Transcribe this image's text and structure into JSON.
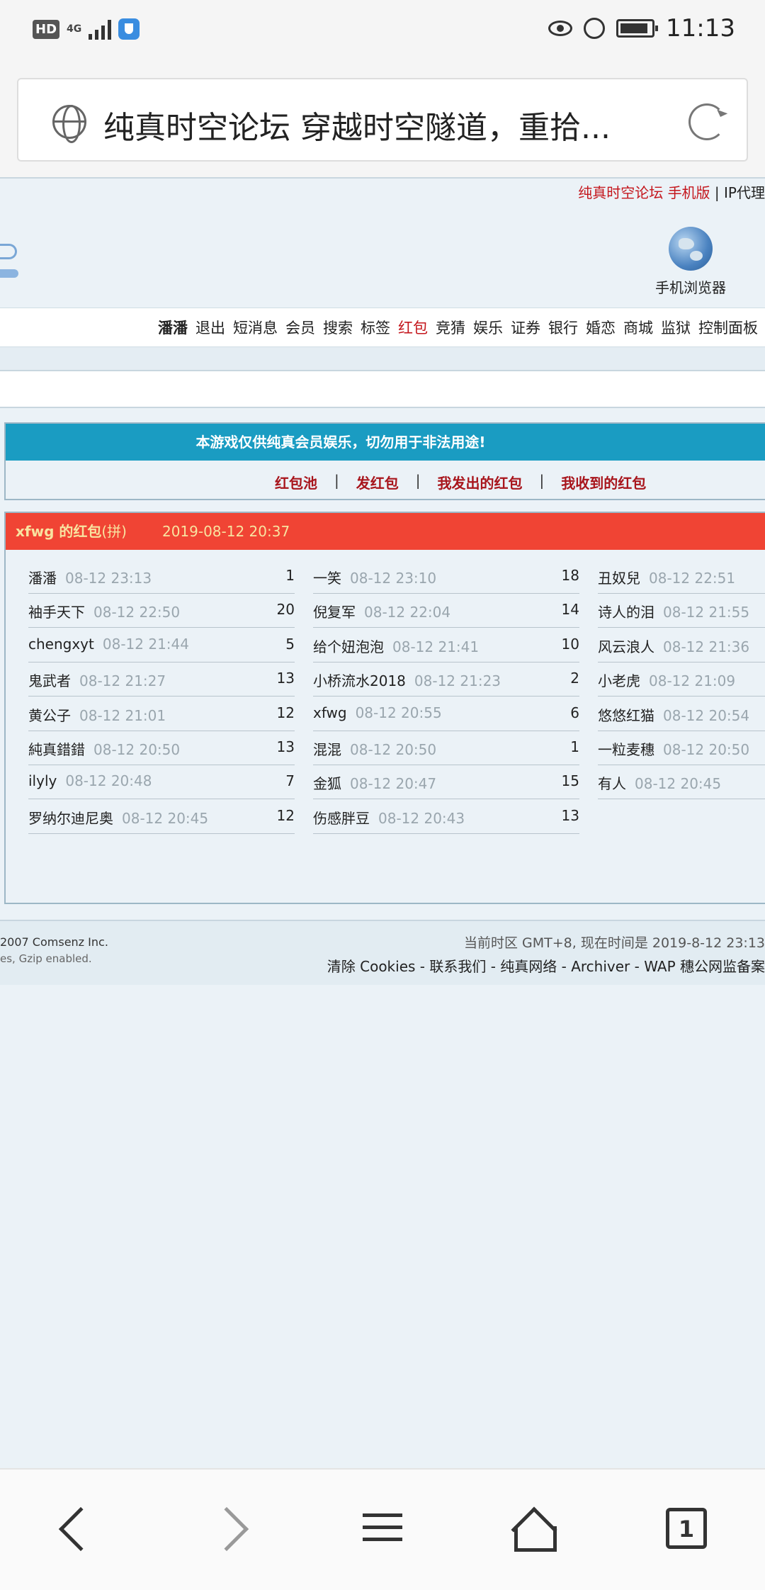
{
  "status_bar": {
    "hd": "HD",
    "network": "4G",
    "time": "11:13"
  },
  "address_bar": {
    "title": "纯真时空论坛 穿越时空隧道，重拾..."
  },
  "top_links": {
    "forum": "纯真时空论坛",
    "mobile": "手机版",
    "separator": "|",
    "ip": "IP代理"
  },
  "mobile_browser": {
    "label": "手机浏览器"
  },
  "nav": {
    "user": "潘潘",
    "items": [
      "退出",
      "短消息",
      "会员",
      "搜索",
      "标签",
      "红包",
      "竞猜",
      "娱乐",
      "证券",
      "银行",
      "婚恋",
      "商城",
      "监狱",
      "控制面板"
    ],
    "active": "红包"
  },
  "notice": {
    "text": "本游戏仅供纯真会员娱乐，切勿用于非法用途!",
    "links": [
      "红包池",
      "发红包",
      "我发出的红包",
      "我收到的红包"
    ],
    "separator": "|"
  },
  "redpacket": {
    "owner": "xfwg 的红包",
    "type": "(拼)",
    "date": "2019-08-12 20:37",
    "entries": [
      {
        "name": "潘潘",
        "time": "08-12 23:13",
        "count": "1"
      },
      {
        "name": "一笑",
        "time": "08-12 23:10",
        "count": "18"
      },
      {
        "name": "丑奴兒",
        "time": "08-12 22:51",
        "count": ""
      },
      {
        "name": "袖手天下",
        "time": "08-12 22:50",
        "count": "20"
      },
      {
        "name": "倪复军",
        "time": "08-12 22:04",
        "count": "14"
      },
      {
        "name": "诗人的泪",
        "time": "08-12 21:55",
        "count": ""
      },
      {
        "name": "chengxyt",
        "time": "08-12 21:44",
        "count": "5"
      },
      {
        "name": "给个妞泡泡",
        "time": "08-12 21:41",
        "count": "10"
      },
      {
        "name": "风云浪人",
        "time": "08-12 21:36",
        "count": ""
      },
      {
        "name": "鬼武者",
        "time": "08-12 21:27",
        "count": "13"
      },
      {
        "name": "小桥流水2018",
        "time": "08-12 21:23",
        "count": "2"
      },
      {
        "name": "小老虎",
        "time": "08-12 21:09",
        "count": ""
      },
      {
        "name": "黄公子",
        "time": "08-12 21:01",
        "count": "12"
      },
      {
        "name": "xfwg",
        "time": "08-12 20:55",
        "count": "6"
      },
      {
        "name": "悠悠红猫",
        "time": "08-12 20:54",
        "count": ""
      },
      {
        "name": "純真錯錯",
        "time": "08-12 20:50",
        "count": "13"
      },
      {
        "name": "混混",
        "time": "08-12 20:50",
        "count": "1"
      },
      {
        "name": "一粒麦穗",
        "time": "08-12 20:50",
        "count": ""
      },
      {
        "name": "ilyly",
        "time": "08-12 20:48",
        "count": "7"
      },
      {
        "name": "金狐",
        "time": "08-12 20:47",
        "count": "15"
      },
      {
        "name": "有人",
        "time": "08-12 20:45",
        "count": ""
      },
      {
        "name": "罗纳尔迪尼奥",
        "time": "08-12 20:45",
        "count": "12"
      },
      {
        "name": "伤感胖豆",
        "time": "08-12 20:43",
        "count": "13"
      }
    ]
  },
  "footer": {
    "copyright": "2007 Comsenz Inc.",
    "gzip": "es, Gzip enabled.",
    "timezone": "当前时区 GMT+8, 现在时间是 2019-8-12 23:13",
    "links": "清除 Cookies - 联系我们 - 纯真网络 - Archiver - WAP 穗公网监备案"
  },
  "bottom_bar": {
    "tab_count": "1"
  },
  "colors": {
    "notice_bg": "#1a9cc2",
    "redpacket_header": "#f04434",
    "link_red": "#a8151c",
    "page_bg": "#ebf2f7"
  }
}
